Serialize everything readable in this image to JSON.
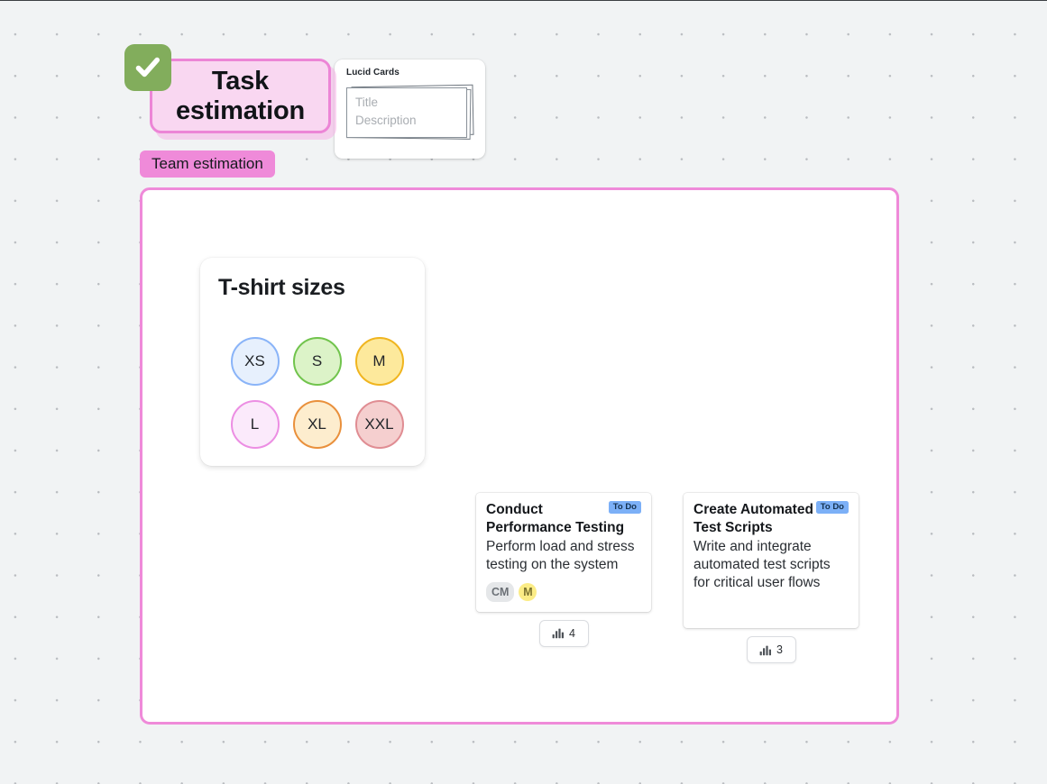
{
  "canvas": {
    "background_color": "#f1f3f4",
    "dot_color": "#b9bcc0"
  },
  "header": {
    "check_icon": "check-icon",
    "title": "Task estimation",
    "title_fill": "#f9d7f1",
    "title_border": "#ec85d6",
    "badge_color": "#82ad5c",
    "team_label": "Team estimation",
    "team_pill_color": "#ef8ad9"
  },
  "lucid_panel": {
    "title": "Lucid Cards",
    "card_title_placeholder": "Title",
    "card_desc_placeholder": "Description"
  },
  "frame": {
    "border_color": "#ef8ad9"
  },
  "tshirt": {
    "title": "T-shirt sizes",
    "sizes": [
      {
        "label": "XS",
        "fill": "#e7f0fd",
        "border": "#8ab4f8"
      },
      {
        "label": "S",
        "fill": "#dcf3c8",
        "border": "#71c44d"
      },
      {
        "label": "M",
        "fill": "#fde99c",
        "border": "#f0b51f"
      },
      {
        "label": "L",
        "fill": "#fbeafb",
        "border": "#ec8ee3"
      },
      {
        "label": "XL",
        "fill": "#fdedce",
        "border": "#e9903c"
      },
      {
        "label": "XXL",
        "fill": "#f5cfcf",
        "border": "#e08d93"
      }
    ]
  },
  "tasks": [
    {
      "status": "To Do",
      "title": "Conduct Performance Testing",
      "description": "Perform load and stress testing on the system",
      "tags": [
        {
          "label": "CM",
          "style": "gray"
        },
        {
          "label": "M",
          "style": "yellow"
        }
      ],
      "vote_count": "4",
      "vote_icon": "bar-chart-icon"
    },
    {
      "status": "To Do",
      "title": "Create Automated Test Scripts",
      "description": "Write and integrate automated test scripts for critical user flows",
      "tags": [],
      "vote_count": "3",
      "vote_icon": "bar-chart-icon"
    }
  ]
}
